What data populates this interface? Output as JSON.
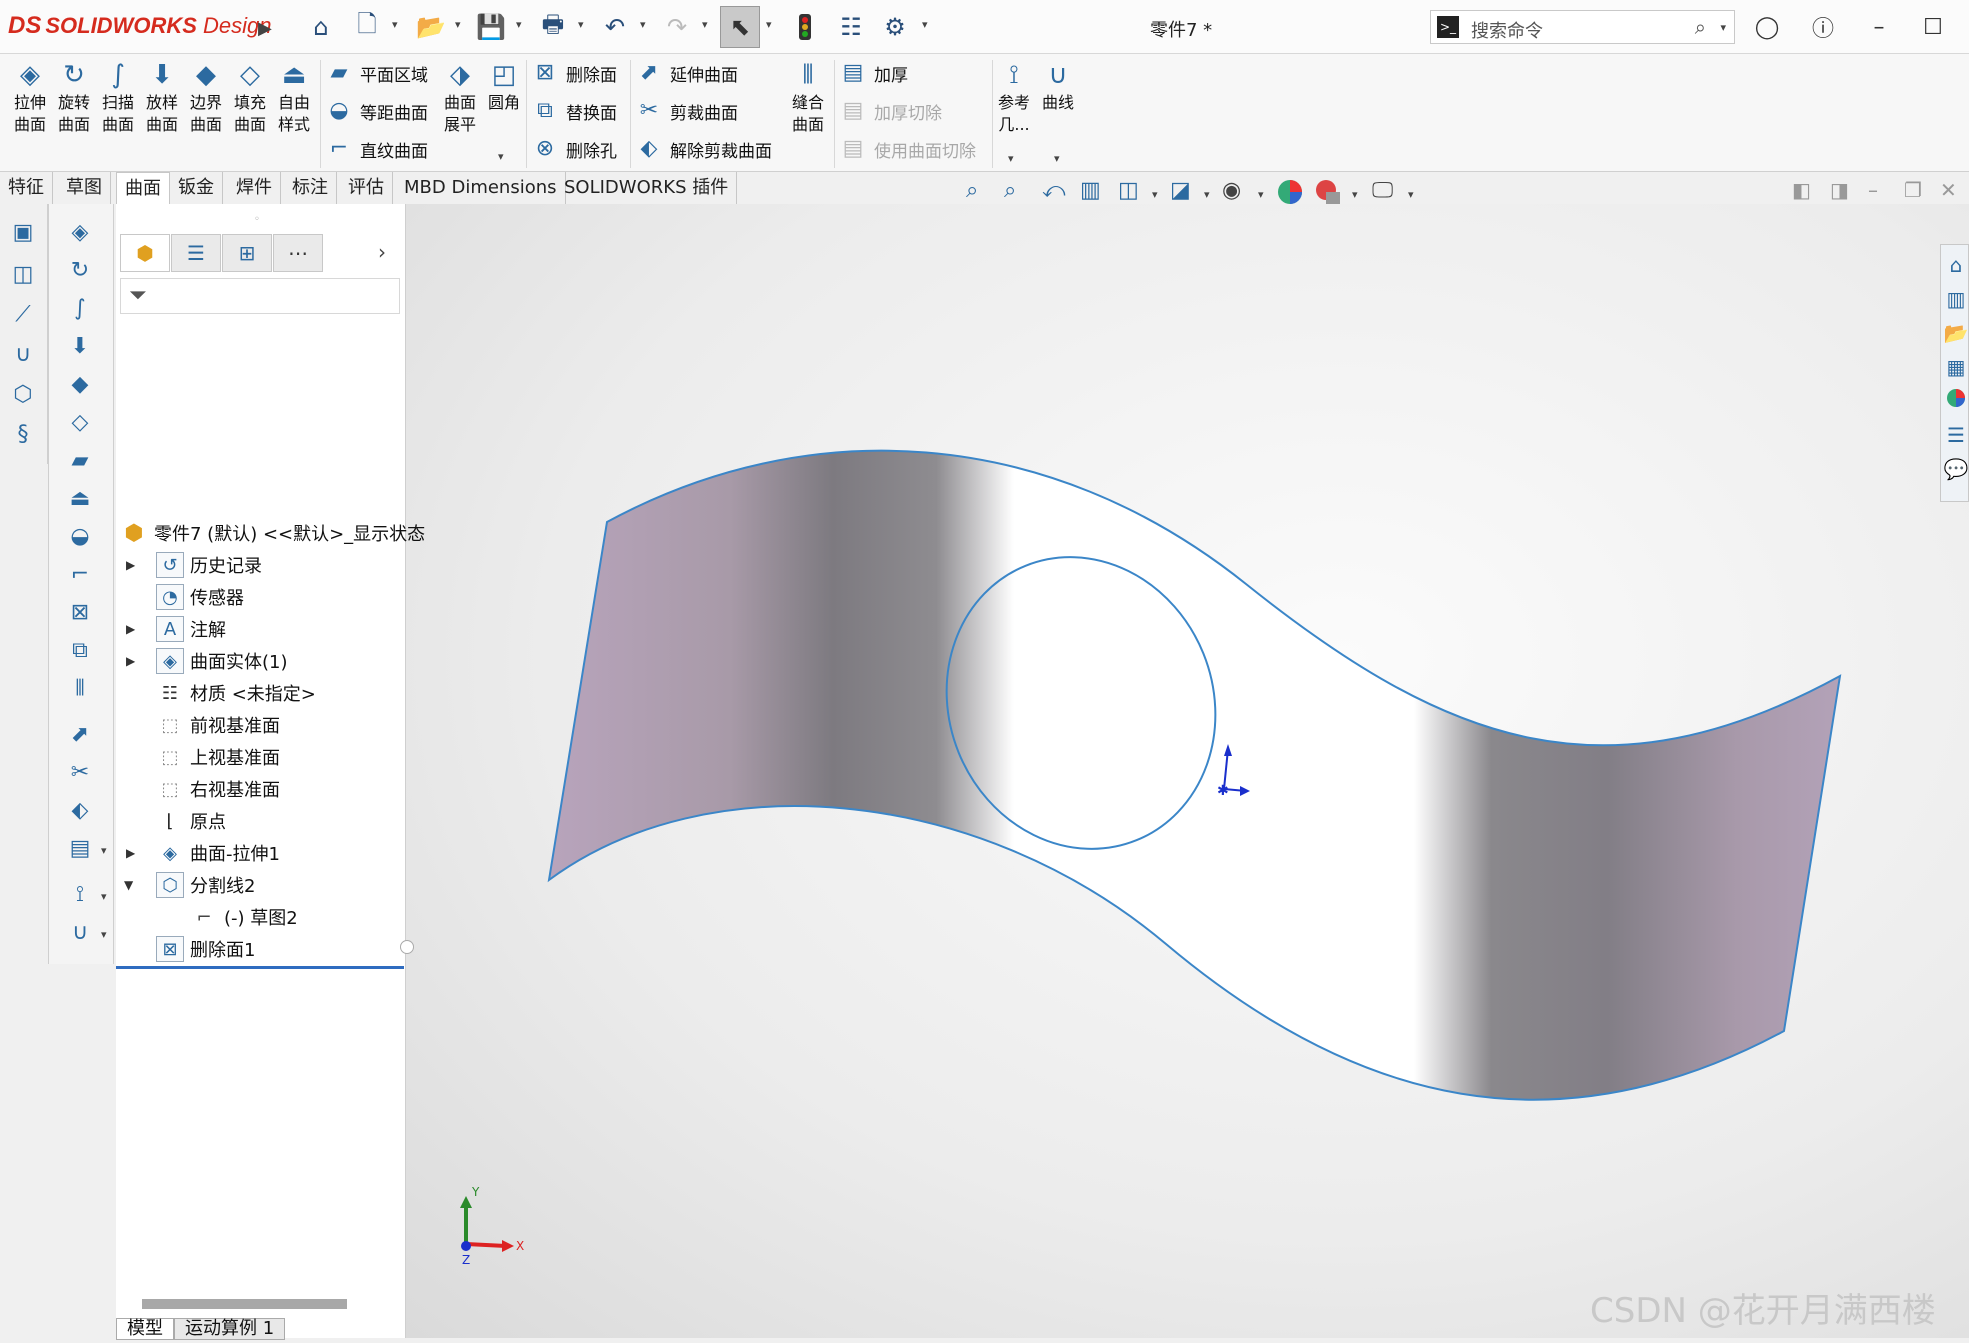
{
  "titlebar": {
    "brand_prefix": "DS",
    "brand_name": "SOLIDWORKS",
    "brand_suffix": "Design",
    "document_title": "零件7 *",
    "search_placeholder": "搜索命令"
  },
  "ribbon": {
    "big_buttons": [
      {
        "label": "拉伸\n曲面",
        "icon": "extrude-surface-icon"
      },
      {
        "label": "旋转\n曲面",
        "icon": "revolve-surface-icon"
      },
      {
        "label": "扫描\n曲面",
        "icon": "sweep-surface-icon"
      },
      {
        "label": "放样\n曲面",
        "icon": "loft-surface-icon"
      },
      {
        "label": "边界\n曲面",
        "icon": "boundary-surface-icon"
      },
      {
        "label": "填充\n曲面",
        "icon": "fill-surface-icon"
      },
      {
        "label": "自由\n样式",
        "icon": "freeform-icon"
      }
    ],
    "col1": [
      "平面区域",
      "等距曲面",
      "直纹曲面"
    ],
    "flatten": "曲面\n展平",
    "fillet": "圆角",
    "col2": [
      "删除面",
      "替换面",
      "删除孔"
    ],
    "col3": [
      "延伸曲面",
      "剪裁曲面",
      "解除剪裁曲面"
    ],
    "knit": "缝合\n曲面",
    "col4": [
      "加厚",
      "加厚切除",
      "使用曲面切除"
    ],
    "ref": "参考\n几...",
    "curves": "曲线"
  },
  "tabs": [
    "特征",
    "草图",
    "曲面",
    "钣金",
    "焊件",
    "标注",
    "评估",
    "MBD Dimensions",
    "SOLIDWORKS 插件"
  ],
  "active_tab": "曲面",
  "feature_tree": {
    "root": "零件7 (默认) <<默认>_显示状态",
    "items": [
      {
        "label": "历史记录",
        "expandable": true
      },
      {
        "label": "传感器",
        "expandable": false
      },
      {
        "label": "注解",
        "expandable": true
      },
      {
        "label": "曲面实体(1)",
        "expandable": true
      },
      {
        "label": "材质 <未指定>",
        "expandable": false
      },
      {
        "label": "前视基准面",
        "expandable": false
      },
      {
        "label": "上视基准面",
        "expandable": false
      },
      {
        "label": "右视基准面",
        "expandable": false
      },
      {
        "label": "原点",
        "expandable": false
      },
      {
        "label": "曲面-拉伸1",
        "expandable": true
      },
      {
        "label": "分割线2",
        "expandable": true,
        "expanded": true
      },
      {
        "label": "(-) 草图2",
        "expandable": false,
        "child": true
      },
      {
        "label": "删除面1",
        "expandable": false
      }
    ]
  },
  "bottom_tabs": [
    "模型",
    "运动算例 1"
  ],
  "triad": {
    "x": "X",
    "y": "Y",
    "z": "Z"
  },
  "watermark": "CSDN @花开月满西楼",
  "colors": {
    "surface_face": "#b3a2b8",
    "surface_edge": "#3b86c8",
    "accent": "#2c6aa0",
    "brand": "#d52b1e"
  }
}
